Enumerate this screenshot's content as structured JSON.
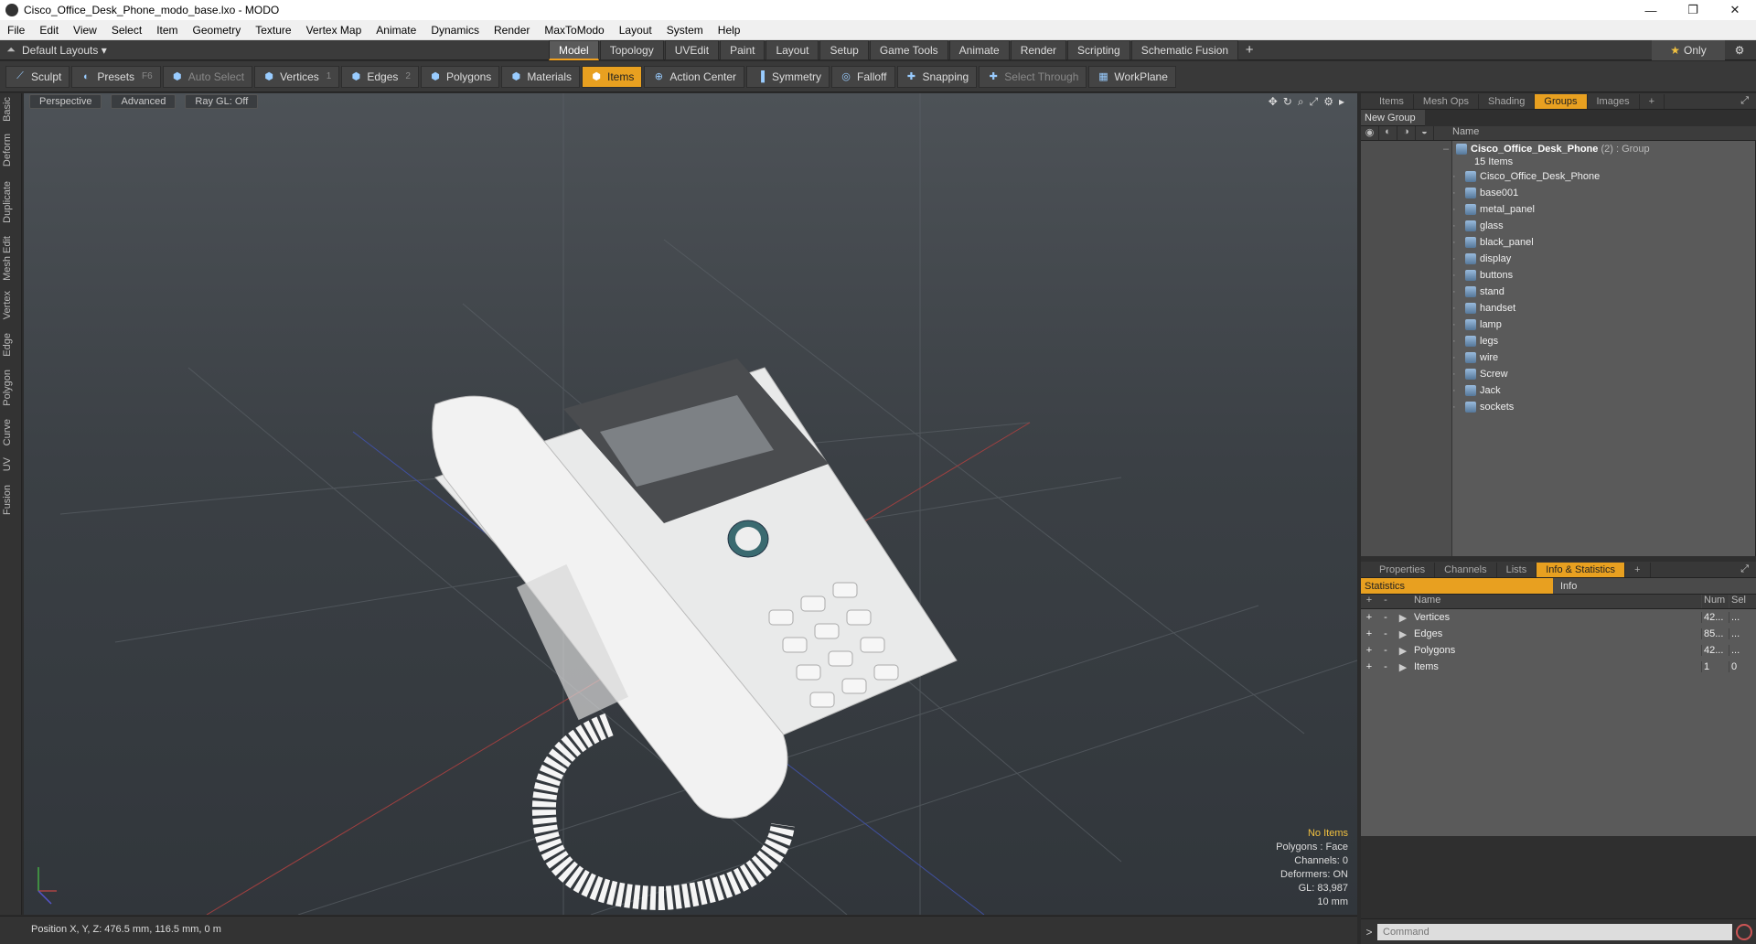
{
  "window": {
    "title": "Cisco_Office_Desk_Phone_modo_base.lxo - MODO",
    "minimize": "—",
    "restore": "❐",
    "close": "✕"
  },
  "menu": [
    "File",
    "Edit",
    "View",
    "Select",
    "Item",
    "Geometry",
    "Texture",
    "Vertex Map",
    "Animate",
    "Dynamics",
    "Render",
    "MaxToModo",
    "Layout",
    "System",
    "Help"
  ],
  "layoutbar": {
    "layout_label": "Default Layouts ▾",
    "tabs": [
      "Model",
      "Topology",
      "UVEdit",
      "Paint",
      "Layout",
      "Setup",
      "Game Tools",
      "Animate",
      "Render",
      "Scripting",
      "Schematic Fusion"
    ],
    "active_tab": "Model",
    "only_label": "Only"
  },
  "toolbar": {
    "sculpt": "Sculpt",
    "presets": "Presets",
    "presets_key": "F6",
    "auto_select": "Auto Select",
    "vertices": "Vertices",
    "vertices_key": "1",
    "edges": "Edges",
    "edges_key": "2",
    "polygons": "Polygons",
    "materials": "Materials",
    "items": "Items",
    "action_center": "Action Center",
    "symmetry": "Symmetry",
    "falloff": "Falloff",
    "snapping": "Snapping",
    "select_through": "Select Through",
    "workplane": "WorkPlane"
  },
  "left_tabs": [
    "Basic",
    "Deform",
    "Duplicate",
    "Mesh Edit",
    "Vertex",
    "Edge",
    "Polygon",
    "Curve",
    "UV",
    "Fusion"
  ],
  "viewport": {
    "view": "Perspective",
    "shading": "Advanced",
    "raygl": "Ray GL: Off",
    "hud": {
      "no_items": "No Items",
      "polygons": "Polygons : Face",
      "channels": "Channels: 0",
      "deformers": "Deformers: ON",
      "gl": "GL: 83,987",
      "scale": "10 mm"
    }
  },
  "status": {
    "position": "Position X, Y, Z:   476.5 mm, 116.5 mm, 0 m"
  },
  "groups_panel": {
    "tabs": [
      "Items",
      "Mesh Ops",
      "Shading",
      "Groups",
      "Images"
    ],
    "active": "Groups",
    "new_group": "New Group",
    "name_col": "Name",
    "group_name": "Cisco_Office_Desk_Phone",
    "group_count": "(2)",
    "group_type": ": Group",
    "items_count": "15 Items",
    "children": [
      "Cisco_Office_Desk_Phone",
      "base001",
      "metal_panel",
      "glass",
      "black_panel",
      "display",
      "buttons",
      "stand",
      "handset",
      "lamp",
      "legs",
      "wire",
      "Screw",
      "Jack",
      "sockets"
    ]
  },
  "stats_panel": {
    "tabs": [
      "Properties",
      "Channels",
      "Lists",
      "Info & Statistics"
    ],
    "active": "Info & Statistics",
    "statistics": "Statistics",
    "info": "Info",
    "cols": {
      "name": "Name",
      "num": "Num",
      "sel": "Sel"
    },
    "rows": [
      {
        "name": "Vertices",
        "num": "42...",
        "sel": "..."
      },
      {
        "name": "Edges",
        "num": "85...",
        "sel": "..."
      },
      {
        "name": "Polygons",
        "num": "42...",
        "sel": "..."
      },
      {
        "name": "Items",
        "num": "1",
        "sel": "0"
      }
    ]
  },
  "command": {
    "placeholder": "Command"
  }
}
